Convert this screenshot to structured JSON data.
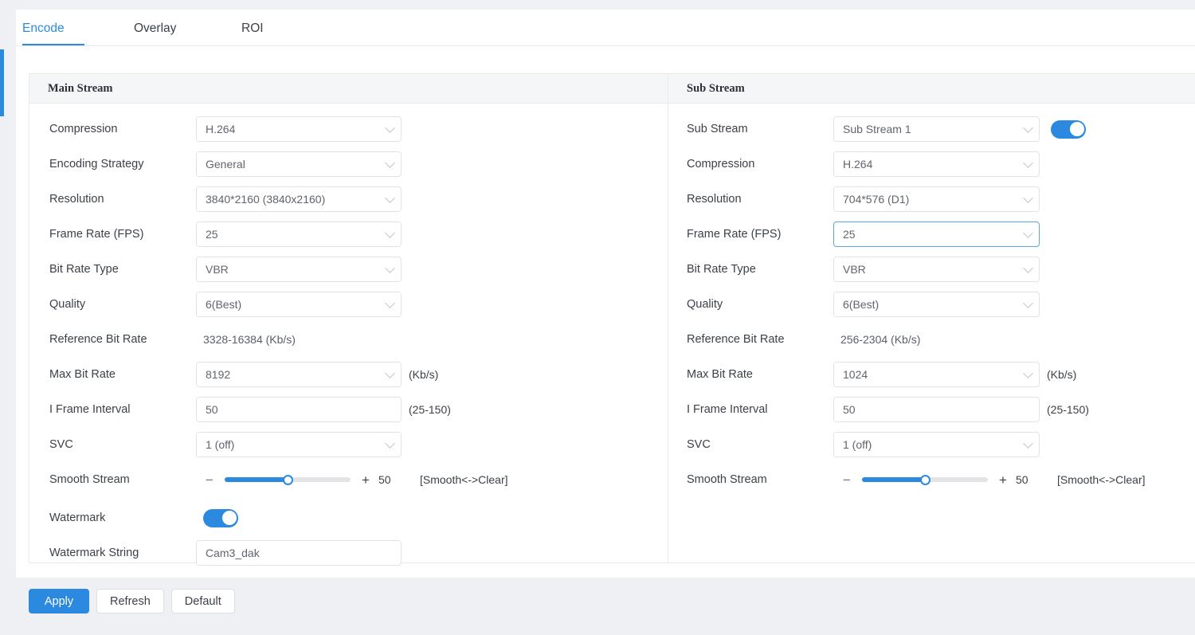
{
  "tabs": [
    {
      "label": "Encode",
      "active": true
    },
    {
      "label": "Overlay",
      "active": false
    },
    {
      "label": "ROI",
      "active": false
    }
  ],
  "colors": {
    "accent": "#2b8ae0",
    "panel_header_bg": "#f5f6f8",
    "border": "#e0e3e8",
    "focus_border": "#5aa7dd",
    "page_bg": "#eef0f4"
  },
  "main_stream": {
    "title": "Main Stream",
    "compression": {
      "label": "Compression",
      "value": "H.264"
    },
    "encoding_strategy": {
      "label": "Encoding Strategy",
      "value": "General"
    },
    "resolution": {
      "label": "Resolution",
      "value": "3840*2160 (3840x2160)"
    },
    "frame_rate": {
      "label": "Frame Rate (FPS)",
      "value": "25"
    },
    "bit_rate_type": {
      "label": "Bit Rate Type",
      "value": "VBR"
    },
    "quality": {
      "label": "Quality",
      "value": "6(Best)"
    },
    "reference_bit_rate": {
      "label": "Reference Bit Rate",
      "value": "3328-16384 (Kb/s)"
    },
    "max_bit_rate": {
      "label": "Max Bit Rate",
      "value": "8192",
      "suffix": "(Kb/s)"
    },
    "i_frame_interval": {
      "label": "I Frame Interval",
      "value": "50",
      "suffix": "(25-150)"
    },
    "svc": {
      "label": "SVC",
      "value": "1 (off)"
    },
    "smooth_stream": {
      "label": "Smooth Stream",
      "value": "50",
      "hint": "[Smooth<->Clear]",
      "minus": "−",
      "plus": "+"
    },
    "watermark": {
      "label": "Watermark",
      "state": "on"
    },
    "watermark_string": {
      "label": "Watermark String",
      "value": "Cam3_dak"
    }
  },
  "sub_stream": {
    "title": "Sub Stream",
    "sub_stream_select": {
      "label": "Sub Stream",
      "value": "Sub Stream 1",
      "toggle_state": "on"
    },
    "compression": {
      "label": "Compression",
      "value": "H.264"
    },
    "resolution": {
      "label": "Resolution",
      "value": "704*576 (D1)"
    },
    "frame_rate": {
      "label": "Frame Rate (FPS)",
      "value": "25",
      "focused": true
    },
    "bit_rate_type": {
      "label": "Bit Rate Type",
      "value": "VBR"
    },
    "quality": {
      "label": "Quality",
      "value": "6(Best)"
    },
    "reference_bit_rate": {
      "label": "Reference Bit Rate",
      "value": "256-2304 (Kb/s)"
    },
    "max_bit_rate": {
      "label": "Max Bit Rate",
      "value": "1024",
      "suffix": "(Kb/s)"
    },
    "i_frame_interval": {
      "label": "I Frame Interval",
      "value": "50",
      "suffix": "(25-150)"
    },
    "svc": {
      "label": "SVC",
      "value": "1 (off)"
    },
    "smooth_stream": {
      "label": "Smooth Stream",
      "value": "50",
      "hint": "[Smooth<->Clear]",
      "minus": "−",
      "plus": "+"
    }
  },
  "buttons": {
    "apply": "Apply",
    "refresh": "Refresh",
    "default": "Default"
  }
}
